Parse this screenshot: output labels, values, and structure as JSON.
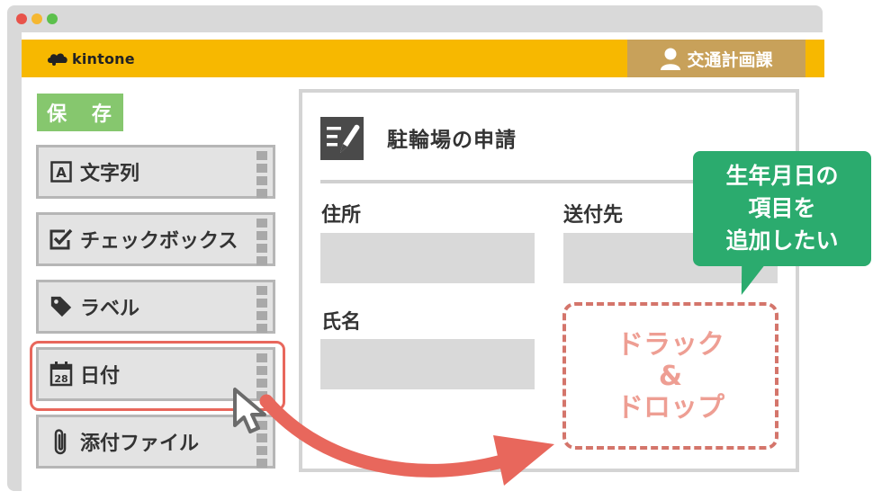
{
  "app": {
    "name": "kintone",
    "user_group": "交通計画課"
  },
  "toolbar": {
    "save_label": "保 存"
  },
  "palette": [
    {
      "label": "文字列",
      "icon": "text-a-icon"
    },
    {
      "label": "チェックボックス",
      "icon": "checkbox-icon"
    },
    {
      "label": "ラベル",
      "icon": "tag-icon"
    },
    {
      "label": "日付",
      "icon": "calendar-icon",
      "icon_text": "28"
    },
    {
      "label": "添付ファイル",
      "icon": "paperclip-icon"
    }
  ],
  "form": {
    "title": "駐輪場の申請",
    "fields": [
      {
        "label": "住所",
        "value": ""
      },
      {
        "label": "送付先",
        "value": ""
      },
      {
        "label": "氏名",
        "value": ""
      }
    ]
  },
  "drop_zone": {
    "line1": "ドラック",
    "line2": "&",
    "line3": "ドロップ"
  },
  "callout": {
    "line1": "生年月日の",
    "line2": "項目を",
    "line3": "追加したい"
  },
  "colors": {
    "header": "#f7b800",
    "save": "#86c76e",
    "highlight": "#e8675c",
    "callout": "#2bab6e"
  }
}
